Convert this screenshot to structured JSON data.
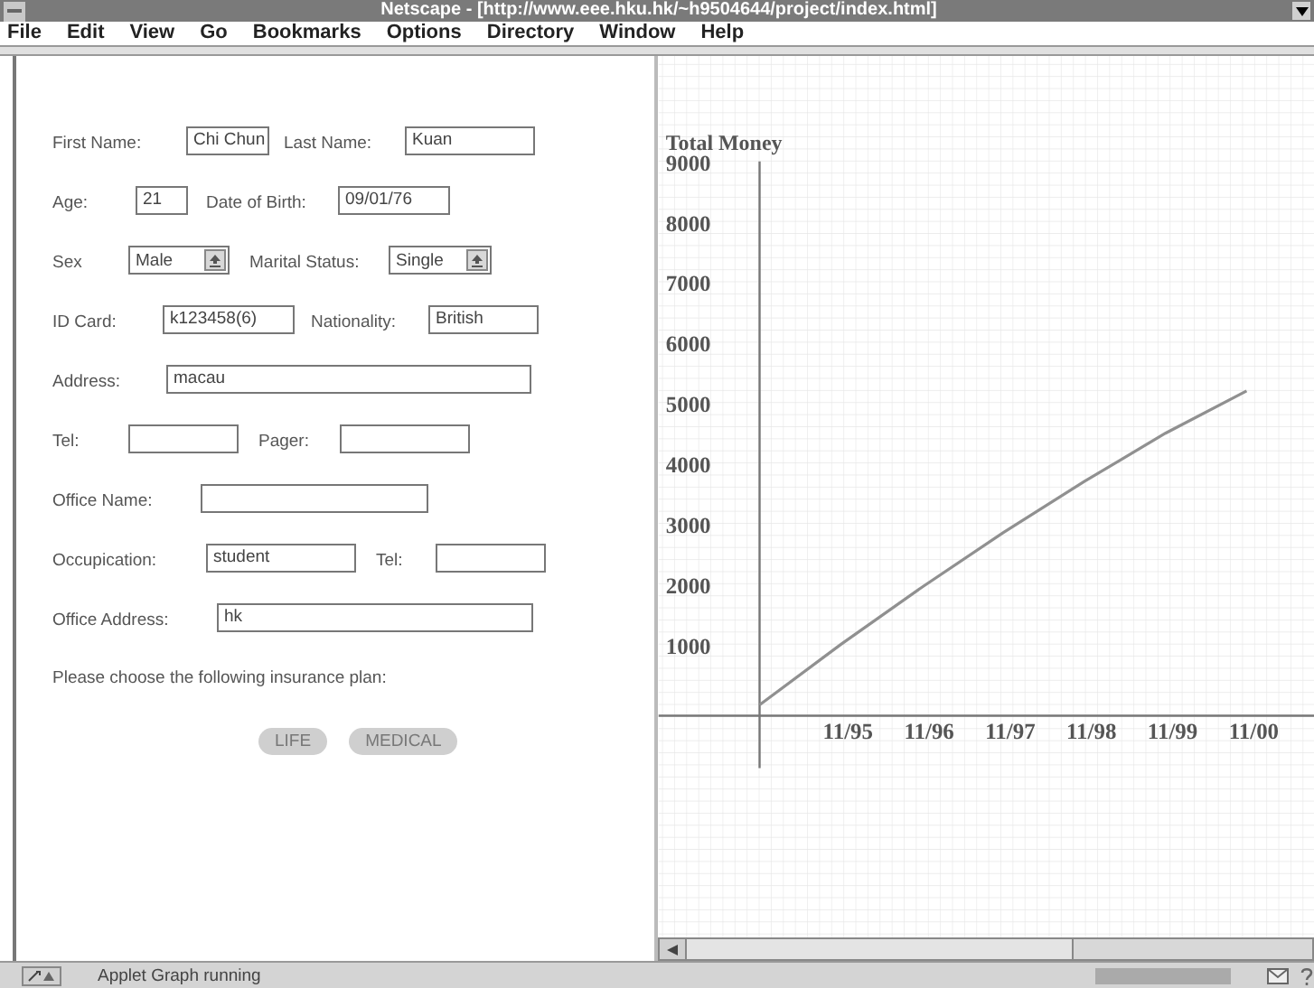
{
  "window": {
    "title": "Netscape - [http://www.eee.hku.hk/~h9504644/project/index.html]"
  },
  "menu": [
    "File",
    "Edit",
    "View",
    "Go",
    "Bookmarks",
    "Options",
    "Directory",
    "Window",
    "Help"
  ],
  "form": {
    "rows": [
      [
        {
          "kind": "label",
          "text": "First Name:"
        },
        {
          "kind": "field",
          "value": "Chi Chun"
        },
        {
          "kind": "label",
          "text": "Last Name:"
        },
        {
          "kind": "field",
          "value": "Kuan"
        }
      ],
      [
        {
          "kind": "label",
          "text": "Age:"
        },
        {
          "kind": "field",
          "value": "21"
        },
        {
          "kind": "label",
          "text": "Date of Birth:"
        },
        {
          "kind": "field",
          "value": "09/01/76"
        }
      ],
      [
        {
          "kind": "label",
          "text": "Sex"
        },
        {
          "kind": "select",
          "value": "Male"
        },
        {
          "kind": "label",
          "text": "Marital Status:"
        },
        {
          "kind": "select",
          "value": "Single"
        }
      ],
      [
        {
          "kind": "label",
          "text": "ID Card:"
        },
        {
          "kind": "field",
          "value": "k123458(6)"
        },
        {
          "kind": "label",
          "text": "Nationality:"
        },
        {
          "kind": "field",
          "value": "British"
        }
      ],
      [
        {
          "kind": "label",
          "text": "Address:"
        },
        {
          "kind": "field",
          "value": "macau"
        }
      ],
      [
        {
          "kind": "label",
          "text": "Tel:"
        },
        {
          "kind": "field"
        },
        {
          "kind": "label",
          "text": "Pager:"
        },
        {
          "kind": "field"
        }
      ],
      [
        {
          "kind": "label",
          "text": "Office Name:"
        },
        {
          "kind": "field"
        }
      ],
      [
        {
          "kind": "label",
          "text": "Occupication:"
        },
        {
          "kind": "field",
          "value": "student"
        },
        {
          "kind": "label",
          "text": "Tel:"
        },
        {
          "kind": "field"
        }
      ],
      [
        {
          "kind": "label",
          "text": "Office Address:"
        },
        {
          "kind": "field",
          "value": "hk"
        }
      ]
    ],
    "prompt": "Please choose the following insurance plan:",
    "buttons": [
      "LIFE",
      "MEDICAL"
    ]
  },
  "chart": {
    "chart_data": {
      "type": "line",
      "ylabel": "Total Money",
      "categories": [
        null,
        "11/95",
        "11/96",
        "11/97",
        "11/98",
        "11/99",
        "11/00"
      ],
      "series": [
        {
          "color": "#909090",
          "values": [
            0,
            1000,
            1950,
            2850,
            3700,
            4500,
            5200
          ]
        }
      ],
      "ylim": [
        0,
        9000
      ],
      "yticks": [
        1000,
        2000,
        3000,
        4000,
        5000,
        6000,
        7000,
        8000,
        9000
      ]
    }
  },
  "status_bar": {
    "text": "Applet Graph running"
  }
}
